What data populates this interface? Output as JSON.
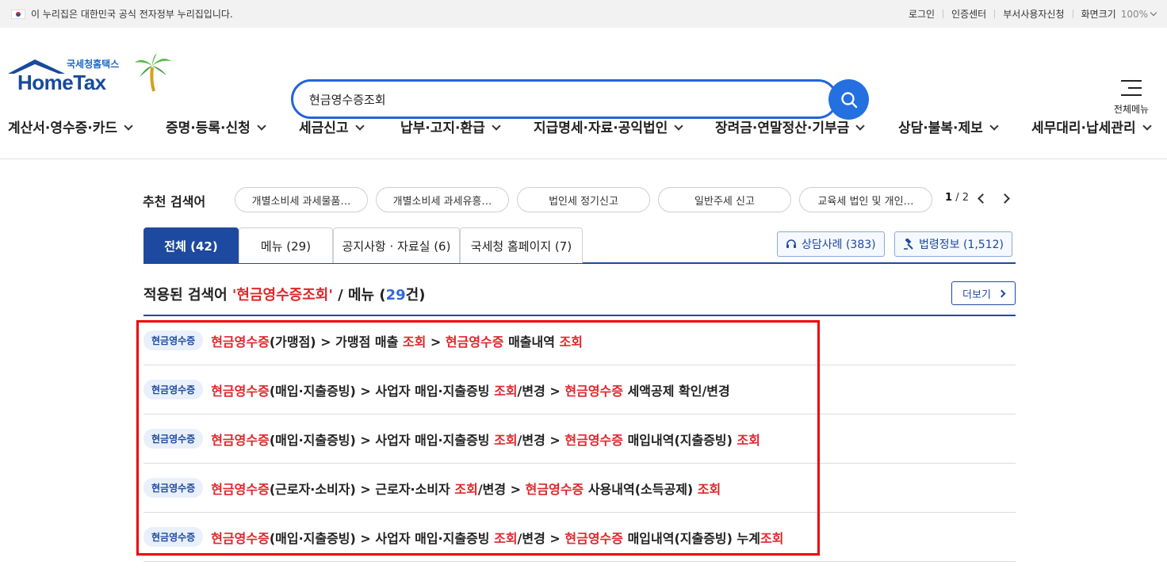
{
  "topbar": {
    "notice": "이 누리집은 대한민국 공식 전자정부 누리집입니다.",
    "links": [
      "로그인",
      "인증센터",
      "부서사용자신청"
    ],
    "zoom_label": "화면크기",
    "zoom_value": "100%"
  },
  "logo": {
    "small": "국세청홈택스",
    "big": "HomeTax"
  },
  "search": {
    "value": "현금영수증조회"
  },
  "all_menu_label": "전체메뉴",
  "gnb": [
    "계산서·영수증·카드",
    "증명·등록·신청",
    "세금신고",
    "납부·고지·환급",
    "지급명세·자료·공익법인",
    "장려금·연말정산·기부금",
    "상담·불복·제보",
    "세무대리·납세관리"
  ],
  "recommend": {
    "label": "추천 검색어",
    "chips": [
      "개별소비세 과세물품…",
      "개별소비세 과세유흥…",
      "법인세 정기신고",
      "일반주세 신고",
      "교육세 법인 및 개인…"
    ],
    "page_current": "1",
    "page_total": "/ 2"
  },
  "tabs": [
    "전체 (42)",
    "메뉴 (29)",
    "공지사항 · 자료실 (6)",
    "국세청 홈페이지 (7)"
  ],
  "side_buttons": [
    "상담사례 (383)",
    "법령정보 (1,512)"
  ],
  "applied": {
    "prefix": "적용된 검색어 ",
    "term": "'현금영수증조회'",
    "middle": " / 메뉴 (",
    "count": "29",
    "suffix": "건)",
    "more": "더보기"
  },
  "results": [
    {
      "badge": "현금영수증",
      "parts": [
        [
          "현금영수증",
          1
        ],
        [
          "(가맹점) > 가맹점 매출 ",
          0
        ],
        [
          "조회",
          1
        ],
        [
          " > ",
          0
        ],
        [
          "현금영수증",
          1
        ],
        [
          " 매출내역 ",
          0
        ],
        [
          "조회",
          1
        ]
      ]
    },
    {
      "badge": "현금영수증",
      "parts": [
        [
          "현금영수증",
          1
        ],
        [
          "(매입·지출증빙) > 사업자 매입·지출증빙 ",
          0
        ],
        [
          "조회",
          1
        ],
        [
          "/변경 > ",
          0
        ],
        [
          "현금영수증",
          1
        ],
        [
          " 세액공제 확인/변경",
          0
        ]
      ]
    },
    {
      "badge": "현금영수증",
      "parts": [
        [
          "현금영수증",
          1
        ],
        [
          "(매입·지출증빙) > 사업자 매입·지출증빙 ",
          0
        ],
        [
          "조회",
          1
        ],
        [
          "/변경 > ",
          0
        ],
        [
          "현금영수증",
          1
        ],
        [
          " 매입내역(지출증빙) ",
          0
        ],
        [
          "조회",
          1
        ]
      ]
    },
    {
      "badge": "현금영수증",
      "parts": [
        [
          "현금영수증",
          1
        ],
        [
          "(근로자·소비자) > 근로자·소비자 ",
          0
        ],
        [
          "조회",
          1
        ],
        [
          "/변경 > ",
          0
        ],
        [
          "현금영수증",
          1
        ],
        [
          " 사용내역(소득공제) ",
          0
        ],
        [
          "조회",
          1
        ]
      ]
    },
    {
      "badge": "현금영수증",
      "parts": [
        [
          "현금영수증",
          1
        ],
        [
          "(매입·지출증빙) > 사업자 매입·지출증빙 ",
          0
        ],
        [
          "조회",
          1
        ],
        [
          "/변경 > ",
          0
        ],
        [
          "현금영수증",
          1
        ],
        [
          " 매입내역(지출증빙) 누계",
          0
        ],
        [
          "조회",
          1
        ]
      ]
    }
  ],
  "colors": {
    "primary": "#1d4aa0",
    "highlight": "#e0262c",
    "search_border": "#2464d8"
  }
}
